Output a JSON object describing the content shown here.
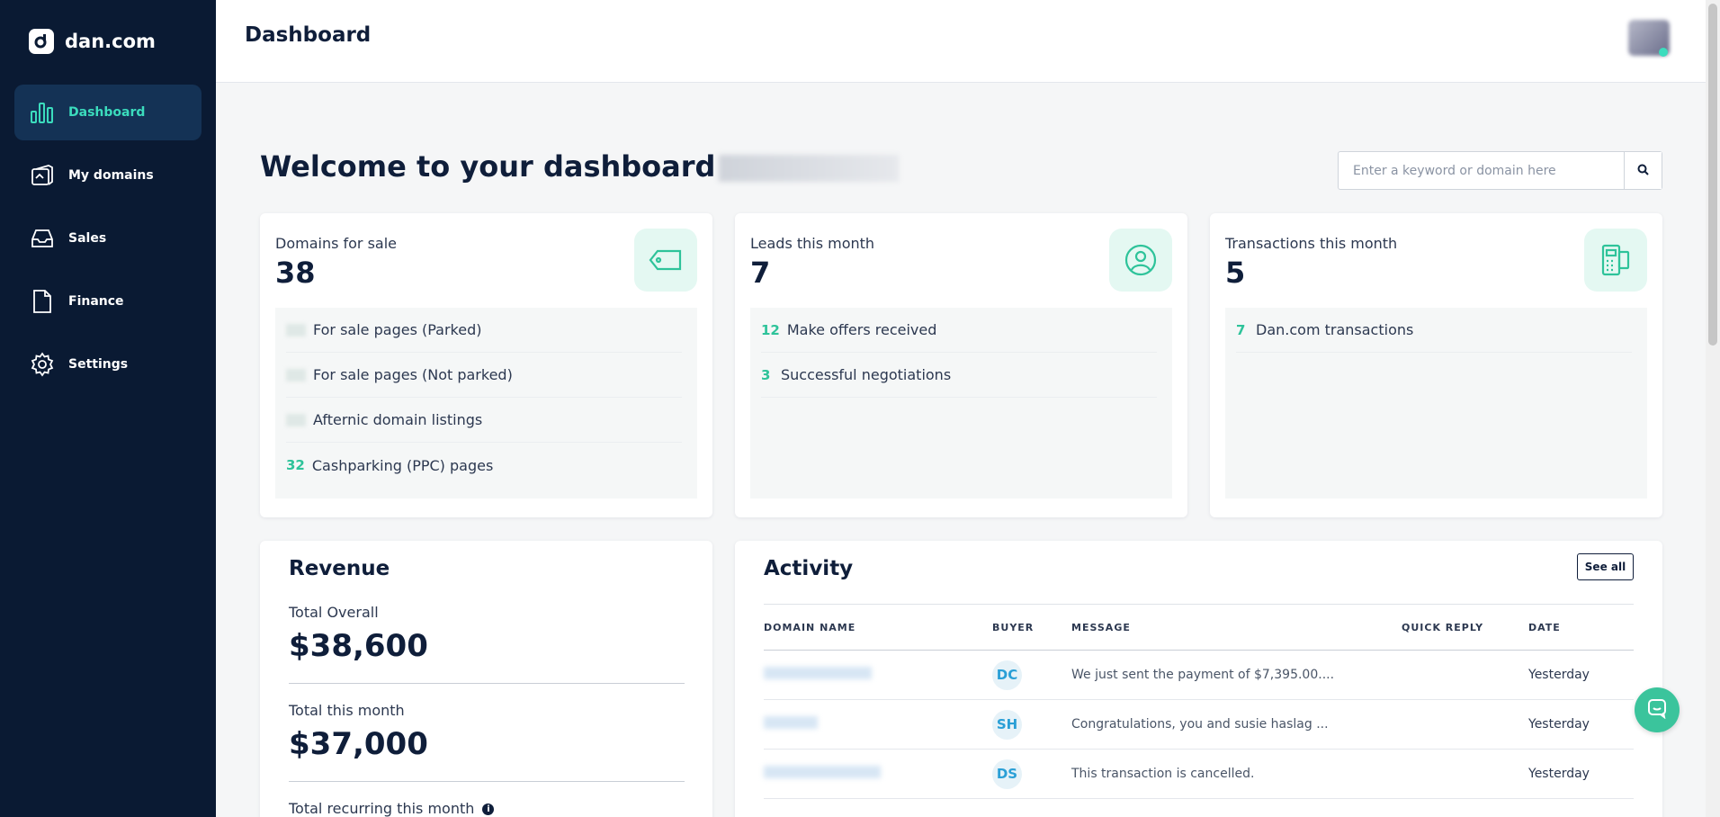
{
  "brand": {
    "name": "dan.com"
  },
  "sidebar": {
    "items": [
      {
        "label": "Dashboard",
        "icon": "bar-chart-icon",
        "active": true
      },
      {
        "label": "My domains",
        "icon": "domains-icon"
      },
      {
        "label": "Sales",
        "icon": "inbox-icon"
      },
      {
        "label": "Finance",
        "icon": "document-icon"
      },
      {
        "label": "Settings",
        "icon": "gear-icon"
      }
    ]
  },
  "header": {
    "title": "Dashboard"
  },
  "welcome": {
    "text": "Welcome to your dashboard"
  },
  "search": {
    "placeholder": "Enter a keyword or domain here",
    "icon": "search-icon"
  },
  "cards": {
    "domains": {
      "title": "Domains for sale",
      "value": "38",
      "icon": "tag-icon",
      "rows": [
        {
          "num": "",
          "label": "For sale pages (Parked)"
        },
        {
          "num": "",
          "label": "For sale pages (Not parked)"
        },
        {
          "num": "",
          "label": "Afternic domain listings"
        },
        {
          "num": "32",
          "label": "Cashparking (PPC) pages"
        }
      ]
    },
    "leads": {
      "title": "Leads this month",
      "value": "7",
      "icon": "user-circle-icon",
      "rows": [
        {
          "num": "12",
          "label": "Make offers received"
        },
        {
          "num": "3",
          "label": "Successful negotiations"
        }
      ]
    },
    "transactions": {
      "title": "Transactions this month",
      "value": "5",
      "icon": "payment-terminal-icon",
      "rows": [
        {
          "num": "7",
          "label": "Dan.com transactions"
        }
      ]
    }
  },
  "revenue": {
    "title": "Revenue",
    "total_label": "Total Overall",
    "total_value": "$38,600",
    "month_label": "Total this month",
    "month_value": "$37,000",
    "recurring_label": "Total recurring this month"
  },
  "activity": {
    "title": "Activity",
    "see_all": "See all",
    "columns": [
      "DOMAIN NAME",
      "BUYER",
      "MESSAGE",
      "QUICK REPLY",
      "DATE"
    ],
    "rows": [
      {
        "buyer": "DC",
        "message": "We just sent the payment of $7,395.00....",
        "date": "Yesterday"
      },
      {
        "buyer": "SH",
        "message": "Congratulations, you and susie haslag ...",
        "date": "Yesterday"
      },
      {
        "buyer": "DS",
        "message": "This transaction is cancelled.",
        "date": "Yesterday"
      }
    ]
  },
  "colors": {
    "sidebar_bg": "#0a1a33",
    "accent": "#3bdcbd",
    "green": "#2ec39a",
    "buyer_badge": "#2a9fd6"
  }
}
